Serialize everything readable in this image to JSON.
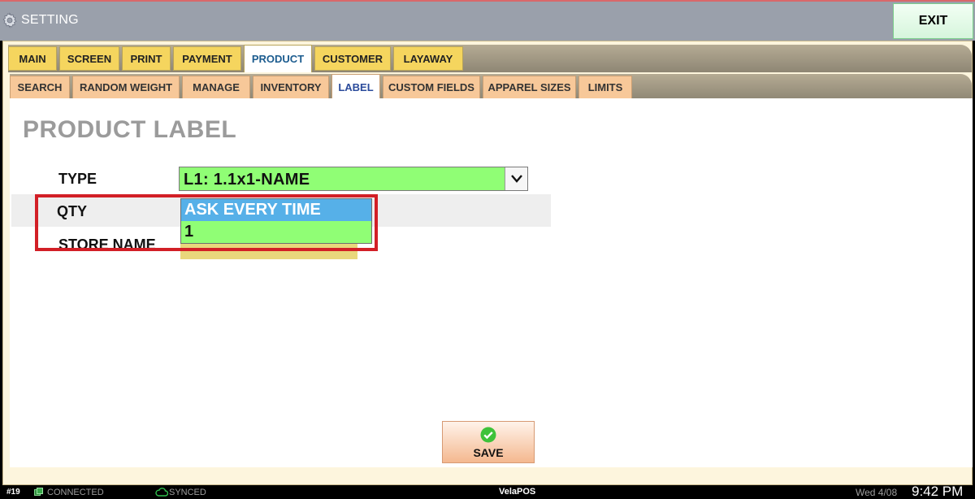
{
  "window": {
    "title": "SETTING",
    "exit_label": "EXIT"
  },
  "tabs_main": [
    "MAIN",
    "SCREEN",
    "PRINT",
    "PAYMENT",
    "PRODUCT",
    "CUSTOMER",
    "LAYAWAY"
  ],
  "tabs_main_active": "PRODUCT",
  "tabs_sub": [
    "SEARCH",
    "RANDOM WEIGHT",
    "MANAGE",
    "INVENTORY",
    "LABEL",
    "CUSTOM FIELDS",
    "APPAREL SIZES",
    "LIMITS"
  ],
  "tabs_sub_active": "LABEL",
  "page": {
    "title": "PRODUCT LABEL"
  },
  "form": {
    "type_label": "TYPE",
    "type_value": "L1: 1.1x1-NAME",
    "qty_label": "QTY",
    "store_name_label": "STORE NAME"
  },
  "qty_dropdown": {
    "options": [
      "ASK EVERY TIME",
      "1"
    ],
    "selected": "ASK EVERY TIME"
  },
  "save_label": "SAVE",
  "status": {
    "station": "#19",
    "connection": "CONNECTED",
    "sync": "SYNCED",
    "brand": "VelaPOS",
    "date": "Wed 4/08",
    "time": "9:42 PM"
  },
  "colors": {
    "title_bar": "#9aa0ab",
    "main_tab": "#f5d55e",
    "sub_tab": "#f7c899",
    "select_green": "#90fe75",
    "selected_option": "#56b0e8",
    "highlight_red": "#d21f26"
  },
  "icons": {
    "title": "gear-icon",
    "save": "check-circle-icon",
    "connection": "connected-icon",
    "sync": "cloud-icon",
    "select": "chevron-down-icon"
  }
}
